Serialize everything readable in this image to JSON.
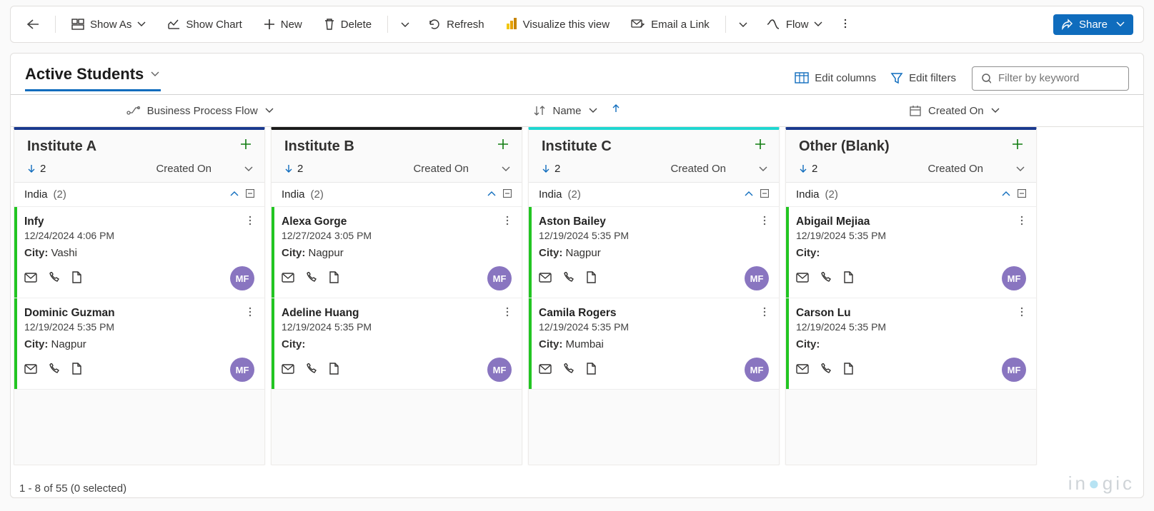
{
  "toolbar": {
    "show_as": "Show As",
    "show_chart": "Show Chart",
    "new": "New",
    "delete": "Delete",
    "refresh": "Refresh",
    "visualize": "Visualize this view",
    "email_link": "Email a Link",
    "flow": "Flow",
    "share": "Share"
  },
  "view": {
    "title": "Active Students",
    "edit_columns": "Edit columns",
    "edit_filters": "Edit filters",
    "search_placeholder": "Filter by keyword"
  },
  "group_row": {
    "col1": "Business Process Flow",
    "col2": "Name",
    "col3": "Created On"
  },
  "columns": [
    {
      "title": "Institute A",
      "accent": "#1b3a8f",
      "sort_count": "2",
      "sort_by": "Created On",
      "group_name": "India",
      "group_count": "(2)",
      "cards": [
        {
          "name": "Infy",
          "date": "12/24/2024 4:06 PM",
          "city_label": "City:",
          "city": "Vashi",
          "avatar": "MF"
        },
        {
          "name": "Dominic Guzman",
          "date": "12/19/2024 5:35 PM",
          "city_label": "City:",
          "city": "Nagpur",
          "avatar": "MF"
        }
      ]
    },
    {
      "title": "Institute B",
      "accent": "#1b1b1b",
      "sort_count": "2",
      "sort_by": "Created On",
      "group_name": "India",
      "group_count": "(2)",
      "cards": [
        {
          "name": "Alexa Gorge",
          "date": "12/27/2024 3:05 PM",
          "city_label": "City:",
          "city": "Nagpur",
          "avatar": "MF"
        },
        {
          "name": "Adeline Huang",
          "date": "12/19/2024 5:35 PM",
          "city_label": "City:",
          "city": "",
          "avatar": "MF"
        }
      ]
    },
    {
      "title": "Institute C",
      "accent": "#1fd7d1",
      "sort_count": "2",
      "sort_by": "Created On",
      "group_name": "India",
      "group_count": "(2)",
      "cards": [
        {
          "name": "Aston Bailey",
          "date": "12/19/2024 5:35 PM",
          "city_label": "City:",
          "city": "Nagpur",
          "avatar": "MF"
        },
        {
          "name": "Camila Rogers",
          "date": "12/19/2024 5:35 PM",
          "city_label": "City:",
          "city": "Mumbai",
          "avatar": "MF"
        }
      ]
    },
    {
      "title": "Other (Blank)",
      "accent": "#1b3a8f",
      "sort_count": "2",
      "sort_by": "Created On",
      "group_name": "India",
      "group_count": "(2)",
      "cards": [
        {
          "name": "Abigail Mejiaa",
          "date": "12/19/2024 5:35 PM",
          "city_label": "City:",
          "city": "",
          "avatar": "MF"
        },
        {
          "name": "Carson Lu",
          "date": "12/19/2024 5:35 PM",
          "city_label": "City:",
          "city": "",
          "avatar": "MF"
        }
      ]
    }
  ],
  "status": "1 - 8 of 55 (0 selected)",
  "brand": "inogic"
}
